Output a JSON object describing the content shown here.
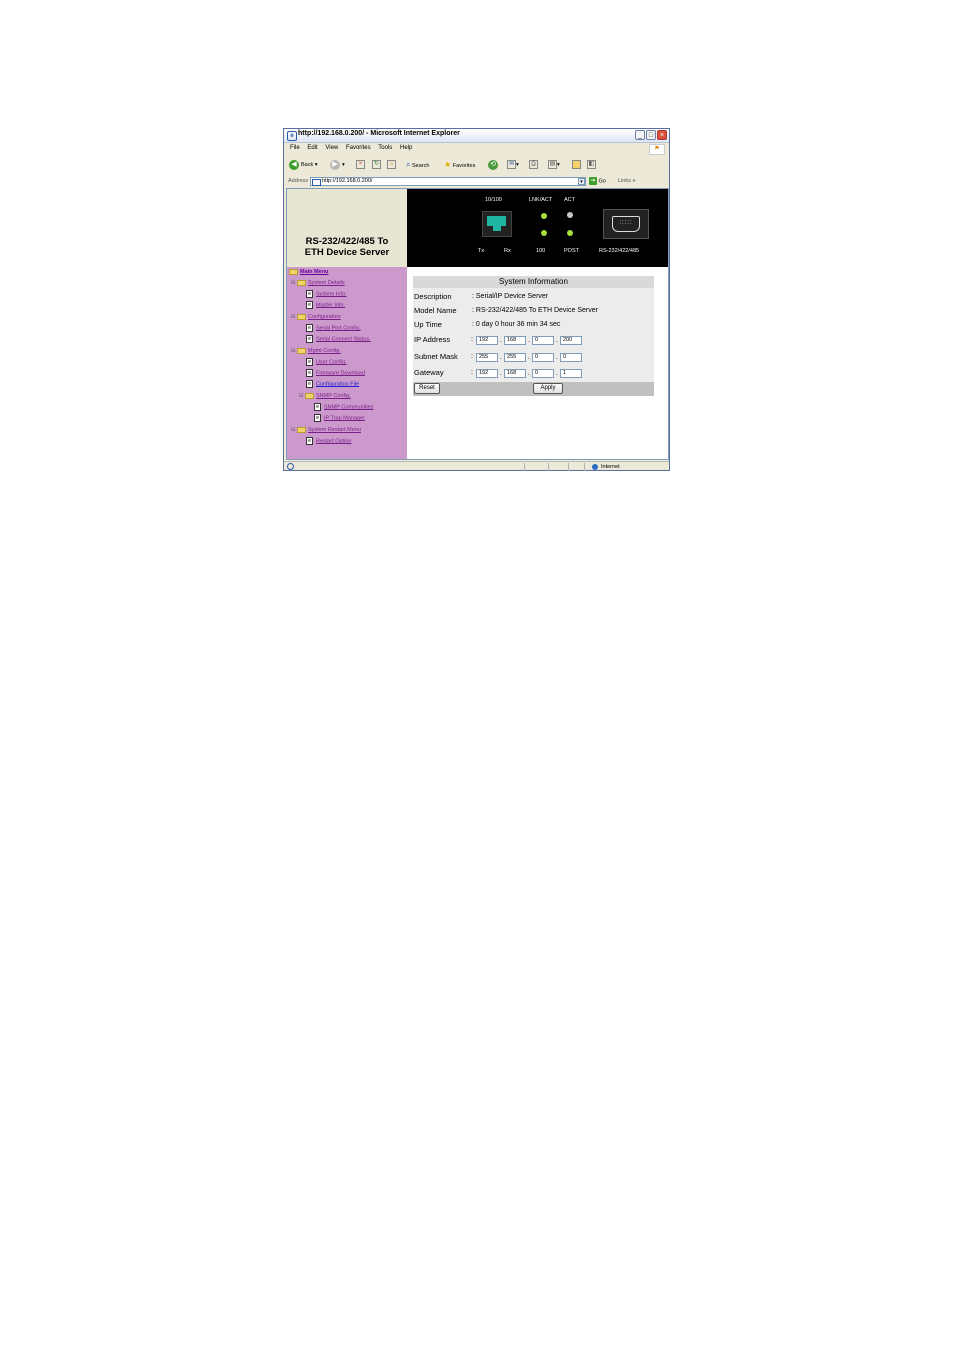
{
  "window": {
    "title": "http://192.168.0.200/ - Microsoft Internet Explorer",
    "min_glyph": "_",
    "max_glyph": "□",
    "close_glyph": "×"
  },
  "menu": [
    "File",
    "Edit",
    "View",
    "Favorites",
    "Tools",
    "Help"
  ],
  "toolbar": {
    "back_label": "Back",
    "search_label": "Search",
    "favorites_label": "Favorites"
  },
  "address": {
    "label": "Address",
    "url": "http://192.168.0.200/",
    "go_label": "Go",
    "links_label": "Links"
  },
  "product": {
    "line1": "RS-232/422/485 To",
    "line2": "ETH Device Server"
  },
  "panel": {
    "eth_label": "10/100",
    "lnk_label": "LNK/ACT",
    "act_label": "ACT",
    "tx_label": "Tx",
    "rx_label": "Rx",
    "speed_label": "100",
    "post_label": "POST",
    "serial_label": "RS-232/422/485",
    "led_color_on": "#a6e03a",
    "led_color_off": "#c8c8c8"
  },
  "sidebar": {
    "main_menu": "Main Menu",
    "system_details": "System Details",
    "system_info": "System Info.",
    "master_info": "Master Info.",
    "configuration": "Configuration",
    "serial_port_config": "Serial Port Config.",
    "serial_connect_status": "Serial Connect Status.",
    "mgmt_config": "Mgmt Config.",
    "user_config": "User Config.",
    "firmware_download": "Firmware Download",
    "configuration_file": "Configuration File",
    "snmp_config": "SNMP Config.",
    "snmp_communities": "SNMP Communities",
    "ip_trap_manager": "IP Trap Manager",
    "system_restart_menu": "System Restart Menu",
    "restart_option": "Restart Option"
  },
  "sysinfo": {
    "title": "System Information",
    "description_label": "Description",
    "description_value": ": Serial/IP Device Server",
    "model_label": "Model Name",
    "model_value": ": RS-232/422/485 To ETH Device Server",
    "uptime_label": "Up Time",
    "uptime_value": ": 0 day 0 hour 36 min 34 sec",
    "ip_label": "IP Address",
    "ip": [
      "192",
      "168",
      "0",
      "200"
    ],
    "mask_label": "Subnet Mask",
    "mask": [
      "255",
      "255",
      "0",
      "0"
    ],
    "gateway_label": "Gateway",
    "gateway": [
      "192",
      "168",
      "0",
      "1"
    ],
    "reset_label": "Reset",
    "apply_label": "Apply"
  },
  "status": {
    "zone": "Internet"
  }
}
